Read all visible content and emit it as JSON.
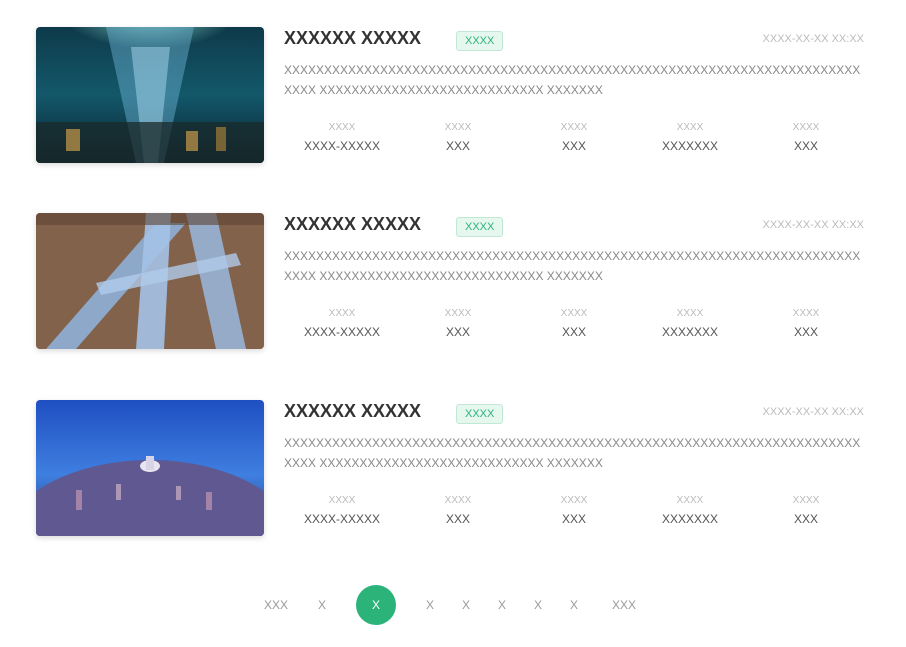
{
  "items": [
    {
      "title": "XXXXXX XXXXX",
      "tag": "XXXX",
      "date": "XXXX-XX-XX XX:XX",
      "description": "XXXXXXXXXXXXXXXXXXXXXXXXXXXXXXXXXXXXXXXXXXXXXXXXXXXXXXXXXXXXXXXXXXXXXXXXXXXXXXXXXXXXXXX XXXX XXXXXXXXXXXXXXXXXXXXXXXXXXXX XXXXXXX",
      "stats": [
        {
          "label": "XXXX",
          "value": "XXXX-XXXXX"
        },
        {
          "label": "XXXX",
          "value": "XXX"
        },
        {
          "label": "XXXX",
          "value": "XXX"
        },
        {
          "label": "XXXX",
          "value": "XXXXXXX"
        },
        {
          "label": "XXXX",
          "value": "XXX"
        }
      ]
    },
    {
      "title": "XXXXXX XXXXX",
      "tag": "XXXX",
      "date": "XXXX-XX-XX XX:XX",
      "description": "XXXXXXXXXXXXXXXXXXXXXXXXXXXXXXXXXXXXXXXXXXXXXXXXXXXXXXXXXXXXXXXXXXXXXXXXXXXXXXXXXXXXXXX XXXX XXXXXXXXXXXXXXXXXXXXXXXXXXXX XXXXXXX",
      "stats": [
        {
          "label": "XXXX",
          "value": "XXXX-XXXXX"
        },
        {
          "label": "XXXX",
          "value": "XXX"
        },
        {
          "label": "XXXX",
          "value": "XXX"
        },
        {
          "label": "XXXX",
          "value": "XXXXXXX"
        },
        {
          "label": "XXXX",
          "value": "XXX"
        }
      ]
    },
    {
      "title": "XXXXXX XXXXX",
      "tag": "XXXX",
      "date": "XXXX-XX-XX XX:XX",
      "description": "XXXXXXXXXXXXXXXXXXXXXXXXXXXXXXXXXXXXXXXXXXXXXXXXXXXXXXXXXXXXXXXXXXXXXXXXXXXXXXXXXXXXXXX XXXX XXXXXXXXXXXXXXXXXXXXXXXXXXXX XXXXXXX",
      "stats": [
        {
          "label": "XXXX",
          "value": "XXXX-XXXXX"
        },
        {
          "label": "XXXX",
          "value": "XXX"
        },
        {
          "label": "XXXX",
          "value": "XXX"
        },
        {
          "label": "XXXX",
          "value": "XXXXXXX"
        },
        {
          "label": "XXXX",
          "value": "XXX"
        }
      ]
    }
  ],
  "pagination": {
    "prev": "XXX",
    "first": "X",
    "current": "X",
    "pages": [
      "X",
      "X",
      "X",
      "X",
      "X"
    ],
    "next": "XXX"
  },
  "colors": {
    "accent": "#2bb37a",
    "title": "#333333",
    "muted": "#bbbbbb"
  }
}
